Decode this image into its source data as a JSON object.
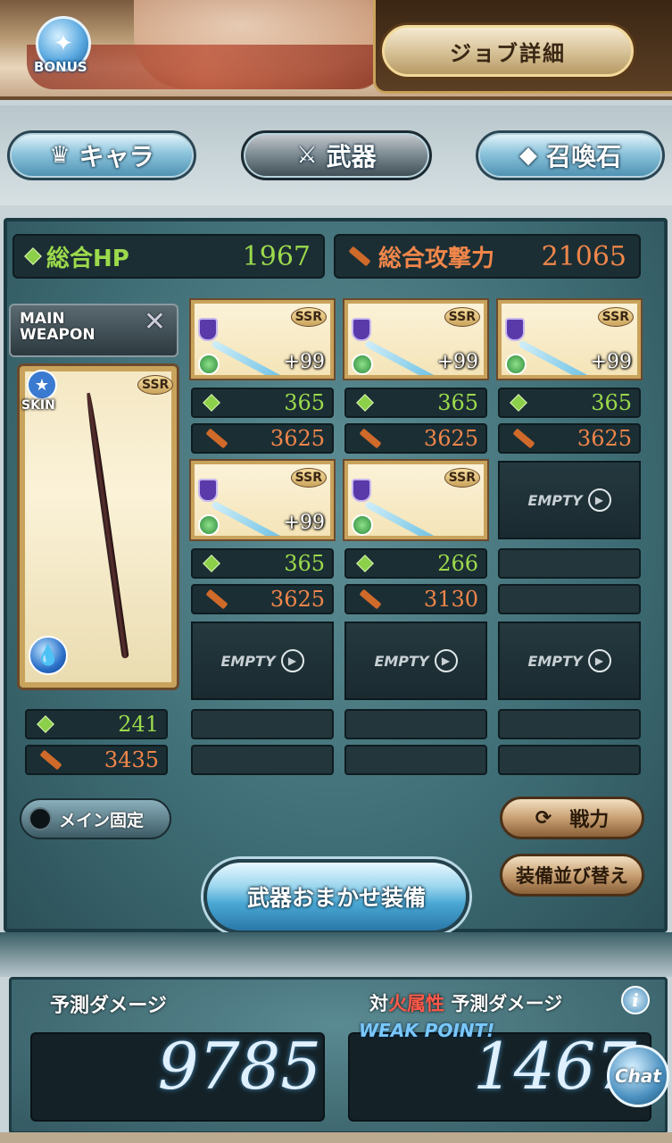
{
  "top": {
    "bonus_label": "BONUS",
    "job_detail_label": "ジョブ詳細"
  },
  "tabs": [
    {
      "label": "キャラ",
      "icon": "character-icon",
      "active": false
    },
    {
      "label": "武器",
      "icon": "crossed-swords-icon",
      "active": true
    },
    {
      "label": "召喚石",
      "icon": "crystal-icon",
      "active": false
    }
  ],
  "totals": {
    "hp_label": "総合HP",
    "hp_value": "1967",
    "atk_label": "総合攻撃力",
    "atk_value": "21065"
  },
  "main_weapon": {
    "header_line1": "MAIN",
    "header_line2": "WEAPON",
    "skin_label": "SKIN",
    "rarity": "SSR",
    "element": "water",
    "hp": "241",
    "atk": "3435"
  },
  "sub_weapons": [
    {
      "rarity": "SSR",
      "level": "+99",
      "hp": "365",
      "atk": "3625",
      "empty": false
    },
    {
      "rarity": "SSR",
      "level": "+99",
      "hp": "365",
      "atk": "3625",
      "empty": false
    },
    {
      "rarity": "SSR",
      "level": "+99",
      "hp": "365",
      "atk": "3625",
      "empty": false
    },
    {
      "rarity": "SSR",
      "level": "+99",
      "hp": "365",
      "atk": "3625",
      "empty": false
    },
    {
      "rarity": "SSR",
      "level": "",
      "hp": "266",
      "atk": "3130",
      "empty": false
    },
    {
      "empty": true,
      "label": "EMPTY"
    },
    {
      "empty": true,
      "label": "EMPTY"
    },
    {
      "empty": true,
      "label": "EMPTY"
    },
    {
      "empty": true,
      "label": "EMPTY"
    }
  ],
  "buttons": {
    "main_lock": "メイン固定",
    "power": "戦力",
    "sort": "装備並び替え",
    "auto_equip": "武器おまかせ装備"
  },
  "damage": {
    "label": "予測ダメージ",
    "value": "9785",
    "fire_prefix": "対",
    "fire_attr": "火属性",
    "fire_suffix": "予測ダメージ",
    "weak_point": "WEAK POINT!",
    "fire_value": "1467",
    "chat_label": "Chat"
  },
  "colors": {
    "hp_green": "#9cda4c",
    "atk_orange": "#f0864a",
    "fire_red": "#ff5a4a",
    "frame_gold": "#c9a35c"
  }
}
